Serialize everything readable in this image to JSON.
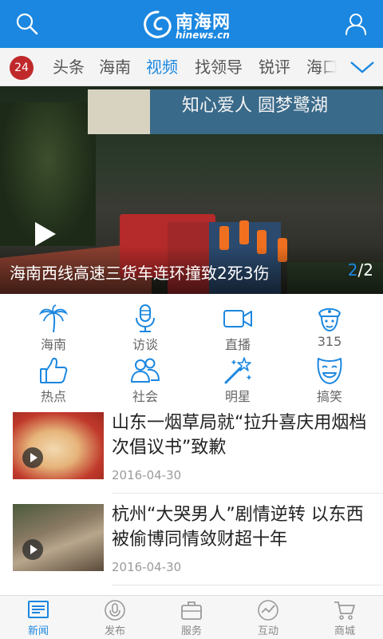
{
  "header": {
    "brand": "南海网",
    "domain": "hinews.cn"
  },
  "tabs": {
    "badge": "24",
    "items": [
      {
        "label": "头条"
      },
      {
        "label": "海南"
      },
      {
        "label": "视频"
      },
      {
        "label": "找领导"
      },
      {
        "label": "锐评"
      },
      {
        "label": "海口"
      }
    ],
    "active_index": 2
  },
  "hero": {
    "billboard": "知心爱人 圆梦鹭湖",
    "title": "海南西线高速三货车连环撞致2死3伤",
    "page_current": "2",
    "page_total": "/2"
  },
  "categories": [
    {
      "label": "海南",
      "icon": "palm-tree-icon"
    },
    {
      "label": "访谈",
      "icon": "microphone-icon"
    },
    {
      "label": "直播",
      "icon": "video-camera-icon"
    },
    {
      "label": "315",
      "icon": "police-officer-icon"
    },
    {
      "label": "热点",
      "icon": "thumbs-up-icon"
    },
    {
      "label": "社会",
      "icon": "people-icon"
    },
    {
      "label": "明星",
      "icon": "magic-wand-icon"
    },
    {
      "label": "搞笑",
      "icon": "smiley-mask-icon"
    }
  ],
  "news": [
    {
      "title": "山东一烟草局就“拉升喜庆用烟档次倡议书”致歉",
      "date": "2016-04-30"
    },
    {
      "title": "杭州“大哭男人”剧情逆转 以东西被偷博同情敛财超十年",
      "date": "2016-04-30"
    }
  ],
  "bottom_nav": {
    "items": [
      {
        "label": "新闻",
        "icon": "newspaper-icon"
      },
      {
        "label": "发布",
        "icon": "microphone-icon"
      },
      {
        "label": "服务",
        "icon": "briefcase-icon"
      },
      {
        "label": "互动",
        "icon": "activity-icon"
      },
      {
        "label": "商城",
        "icon": "shopping-cart-icon"
      }
    ],
    "active_index": 0
  },
  "colors": {
    "accent": "#1b87e0",
    "badge": "#c0292b"
  }
}
